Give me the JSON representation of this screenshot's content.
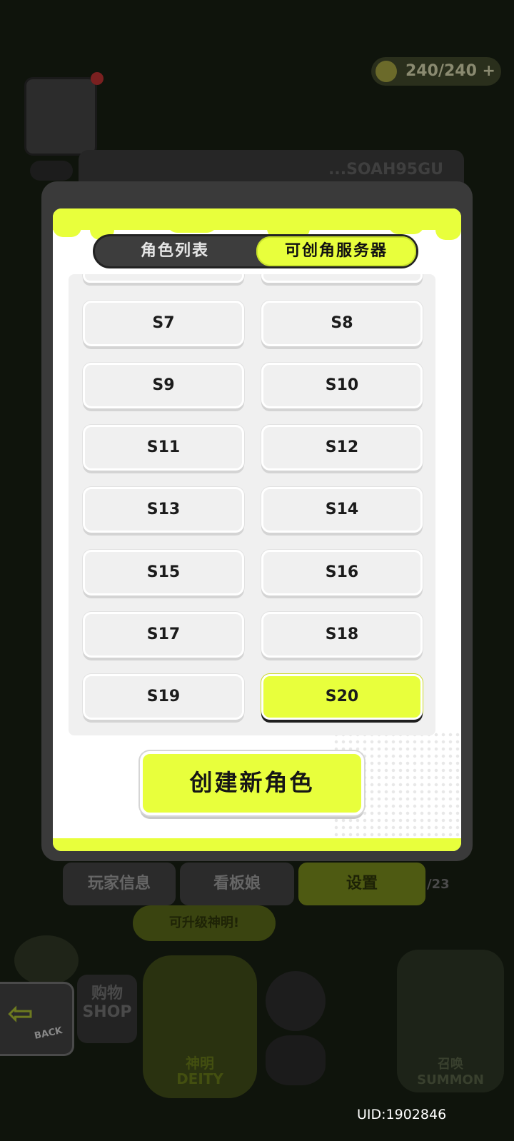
{
  "background": {
    "stamina": "240/240",
    "player_id": "...SOAH95GU",
    "bottom_tabs": [
      "玩家信息",
      "看板娘",
      "设置"
    ],
    "page_indicator": "/23",
    "upgrade_hint": "可升级神明!",
    "shop_label": "购物",
    "shop_label_en": "SHOP",
    "deity_label": "神明",
    "deity_label_en": "DEITY",
    "summon_label": "召唤",
    "summon_label_en": "SUMMON",
    "back_label": "BACK"
  },
  "modal": {
    "tabs": [
      {
        "label": "角色列表",
        "active": false
      },
      {
        "label": "可创角服务器",
        "active": true
      }
    ],
    "servers": [
      "S7",
      "S8",
      "S9",
      "S10",
      "S11",
      "S12",
      "S13",
      "S14",
      "S15",
      "S16",
      "S17",
      "S18",
      "S19",
      "S20"
    ],
    "selected_server": "S20",
    "create_button": "创建新角色"
  },
  "footer": {
    "uid": "UID:1902846"
  },
  "colors": {
    "accent": "#e8ff3c",
    "frame": "#3a3a3a",
    "button_bg": "#f0f0f0"
  }
}
